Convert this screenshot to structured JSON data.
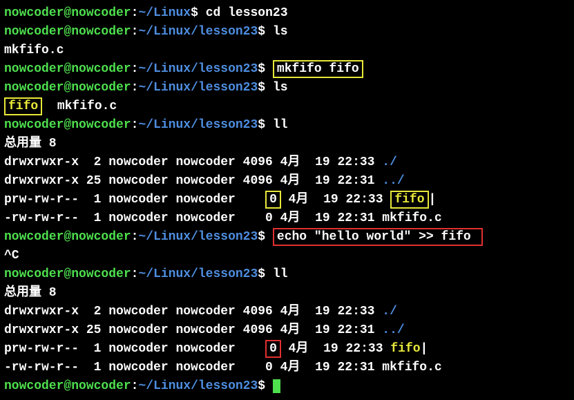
{
  "prompt1": {
    "user": "nowcoder@nowcoder",
    "colon": ":",
    "path": "~/Linux",
    "dollar": "$ ",
    "cmd": "cd lesson23"
  },
  "prompt2": {
    "user": "nowcoder@nowcoder",
    "colon": ":",
    "path": "~/Linux/lesson23",
    "dollar": "$ ",
    "cmd": "ls"
  },
  "ls1": "mkfifo.c",
  "prompt3": {
    "user": "nowcoder@nowcoder",
    "colon": ":",
    "path": "~/Linux/lesson23",
    "dollar": "$ ",
    "cmd": "mkfifo fifo"
  },
  "prompt4": {
    "user": "nowcoder@nowcoder",
    "colon": ":",
    "path": "~/Linux/lesson23",
    "dollar": "$ ",
    "cmd": "ls"
  },
  "ls2": {
    "fifo": "fifo",
    "rest": "  mkfifo.c"
  },
  "prompt5": {
    "user": "nowcoder@nowcoder",
    "colon": ":",
    "path": "~/Linux/lesson23",
    "dollar": "$ ",
    "cmd": "ll"
  },
  "ll1": {
    "total": "总用量 8",
    "r1": "drwxrwxr-x  2 nowcoder nowcoder 4096 4月  19 22:33 ",
    "r1end": "./",
    "r2": "drwxrwxr-x 25 nowcoder nowcoder 4096 4月  19 22:31 ",
    "r2end": "../",
    "r3a": "prw-rw-r--  1 nowcoder nowcoder    ",
    "r3zero": "0",
    "r3b": " 4月  19 22:33 ",
    "r3fifo": "fifo",
    "r3pipe": "|",
    "r4": "-rw-rw-r--  1 nowcoder nowcoder    0 4月  19 22:31 mkfifo.c"
  },
  "prompt6": {
    "user": "nowcoder@nowcoder",
    "colon": ":",
    "path": "~/Linux/lesson23",
    "dollar": "$ ",
    "cmd": "echo \"hello world\" >> fifo "
  },
  "ctrlc": "^C",
  "prompt7": {
    "user": "nowcoder@nowcoder",
    "colon": ":",
    "path": "~/Linux/lesson23",
    "dollar": "$ ",
    "cmd": "ll"
  },
  "ll2": {
    "total": "总用量 8",
    "r1": "drwxrwxr-x  2 nowcoder nowcoder 4096 4月  19 22:33 ",
    "r1end": "./",
    "r2": "drwxrwxr-x 25 nowcoder nowcoder 4096 4月  19 22:31 ",
    "r2end": "../",
    "r3a": "prw-rw-r--  1 nowcoder nowcoder    ",
    "r3zero": "0",
    "r3b": " 4月  19 22:33 ",
    "r3fifo": "fifo",
    "r3pipe": "|",
    "r4": "-rw-rw-r--  1 nowcoder nowcoder    0 4月  19 22:31 mkfifo.c"
  },
  "prompt8": {
    "user": "nowcoder@nowcoder",
    "colon": ":",
    "path": "~/Linux/lesson23",
    "dollar": "$ "
  }
}
